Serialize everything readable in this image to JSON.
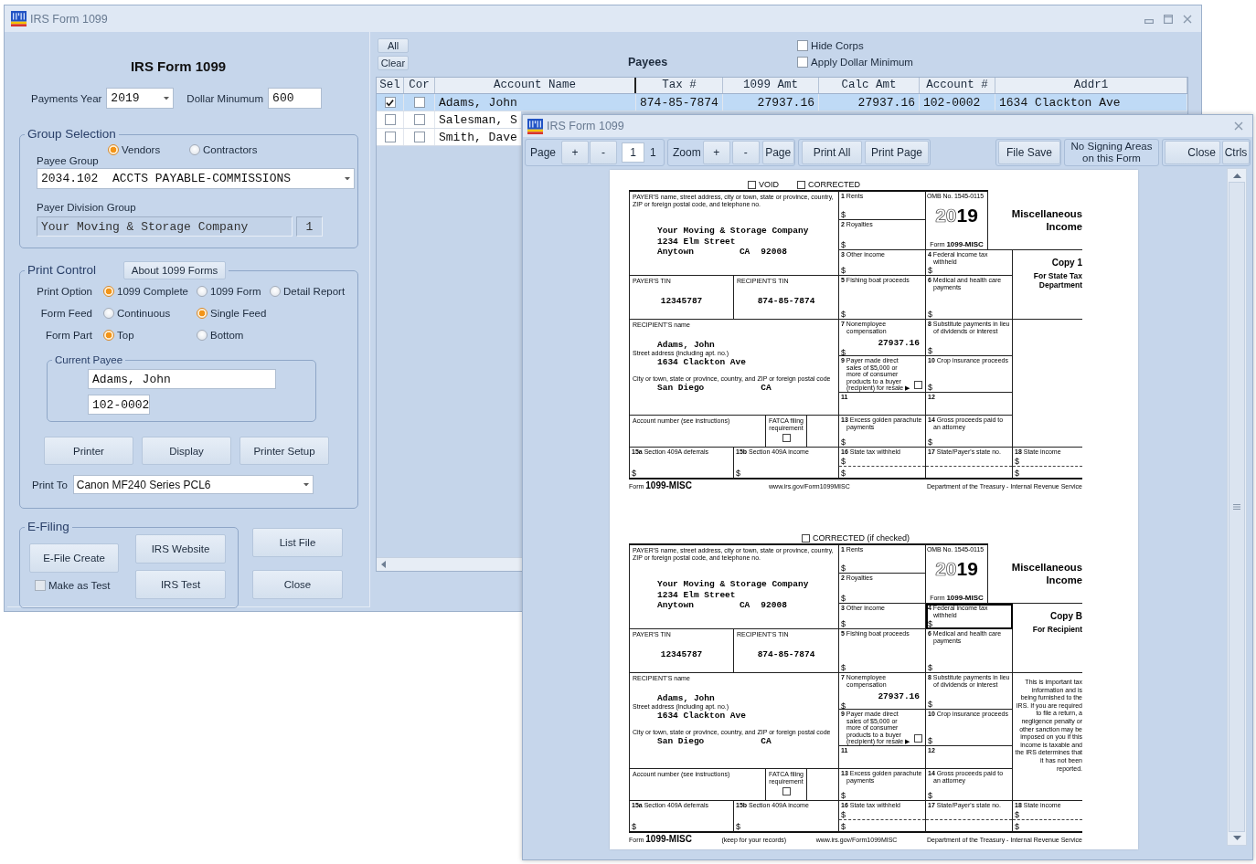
{
  "main_window": {
    "title": "IRS Form 1099",
    "left_panel": {
      "heading": "IRS Form 1099",
      "payments_year": {
        "label": "Payments Year",
        "value": "2019"
      },
      "dollar_minimum": {
        "label": "Dollar Minumum",
        "value": "600"
      },
      "group_selection": {
        "legend": "Group Selection",
        "payee_type": [
          {
            "label": "Vendors",
            "selected": true
          },
          {
            "label": "Contractors",
            "selected": false
          }
        ],
        "payee_group": {
          "label": "Payee Group",
          "value": "2034.102  ACCTS PAYABLE-COMMISSIONS"
        },
        "payer_division_group": {
          "label": "Payer Division Group",
          "value": "Your Moving & Storage Company",
          "number": "1"
        }
      },
      "print_control": {
        "legend": "Print Control",
        "about_button": "About 1099 Forms",
        "options": [
          {
            "label": "Print Option",
            "choices": [
              {
                "label": "1099 Complete",
                "selected": true
              },
              {
                "label": "1099 Form",
                "selected": false
              },
              {
                "label": "Detail Report",
                "selected": false
              }
            ]
          },
          {
            "label": "Form Feed",
            "choices": [
              {
                "label": "Continuous",
                "selected": false
              },
              {
                "label": "Single Feed",
                "selected": true
              }
            ]
          },
          {
            "label": "Form Part",
            "choices": [
              {
                "label": "Top",
                "selected": true
              },
              {
                "label": "Bottom",
                "selected": false
              }
            ]
          }
        ],
        "current_payee": {
          "legend": "Current Payee",
          "name": "Adams, John",
          "account": "102-0002"
        },
        "buttons": [
          "Printer",
          "Display",
          "Printer Setup"
        ],
        "print_to": {
          "label": "Print To",
          "value": "Canon MF240 Series PCL6"
        }
      },
      "e_filing": {
        "legend": "E-Filing",
        "create_button": "E-File Create",
        "make_as_test": {
          "label": "Make as Test",
          "checked": false
        },
        "website_button": "IRS Website",
        "test_button": "IRS Test"
      },
      "list_file_button": "List File",
      "close_button": "Close"
    },
    "payees": {
      "all_button": "All",
      "clear_button": "Clear",
      "title": "Payees",
      "filters": [
        {
          "label": "Hide Corps",
          "checked": false
        },
        {
          "label": "Apply Dollar Minimum",
          "checked": false
        }
      ],
      "table": {
        "check_columns": [
          "Sel",
          "Cor"
        ],
        "columns": [
          "Account Name",
          "Tax #",
          "1099 Amt",
          "Calc Amt",
          "Account #",
          "Addr1"
        ],
        "rows": [
          {
            "selected": true,
            "sel": true,
            "cor": false,
            "cells": [
              "Adams, John",
              "874-85-7874",
              "27937.16",
              "27937.16",
              "102-0002",
              "1634 Clackton Ave"
            ]
          },
          {
            "selected": false,
            "sel": false,
            "cor": false,
            "cells": [
              "Salesman, S"
            ]
          },
          {
            "selected": false,
            "sel": false,
            "cor": false,
            "cells": [
              "Smith, Dave"
            ]
          }
        ]
      }
    }
  },
  "preview_window": {
    "title": "IRS Form 1099",
    "toolbar": {
      "page": {
        "label": "Page",
        "buttons": [
          "+",
          "-"
        ],
        "current": "1",
        "total": "1"
      },
      "zoom": {
        "label": "Zoom",
        "buttons": [
          "+",
          "-",
          "Page"
        ]
      },
      "print_buttons": [
        "Print All",
        "Print Page"
      ],
      "file_save": "File Save",
      "signing_note": "No Signing Areas on this Form",
      "close": "Close",
      "ctrls": "Ctrls"
    },
    "page": {
      "copies": [
        {
          "top_checks": [
            {
              "label": "VOID",
              "checked": false
            },
            {
              "label": "CORRECTED",
              "checked": false
            }
          ],
          "payer": {
            "caption": "PAYER'S name, street address, city or town, state or province, country, ZIP or foreign postal code, and telephone no.",
            "name": "Your Moving & Storage Company",
            "street": "1234 Elm Street",
            "city": "Anytown",
            "state": "CA",
            "zip": "92008"
          },
          "omb": "OMB No. 1545-0115",
          "year_outlined": "20",
          "year_solid": "19",
          "form_name": "Form **1099-MISC**",
          "title": "Miscellaneous Income",
          "payer_tin": {
            "caption": "PAYER'S TIN",
            "value": "12345787"
          },
          "recipient_tin": {
            "caption": "RECIPIENT'S TIN",
            "value": "874-85-7874"
          },
          "recipient": {
            "name_caption": "RECIPIENT'S name",
            "name": "Adams, John",
            "street_caption": "Street address (including apt. no.)",
            "street": "1634 Clackton Ave",
            "city_caption": "City or town, state or province, country, and ZIP or foreign postal code",
            "city": "San Diego",
            "state": "CA"
          },
          "account": {
            "caption": "Account number (see instructions)"
          },
          "fatca": {
            "caption": "FATCA filing requirement",
            "checked": false
          },
          "boxes": [
            {
              "kind": "amount",
              "label": "**1** Rents",
              "amounts": [
                "$"
              ],
              "focused": false
            },
            {
              "kind": "amount",
              "label": "**2** Royalties",
              "amounts": [
                "$"
              ],
              "focused": false
            },
            {
              "kind": "amount",
              "label": "**3** Other income",
              "amounts": [
                "$"
              ],
              "focused": false
            },
            {
              "kind": "amount",
              "label": "**4** Federal income tax withheld",
              "amounts": [
                "$"
              ],
              "focused": false
            },
            {
              "kind": "amount",
              "label": "**5** Fishing boat proceeds",
              "amounts": [
                "$"
              ],
              "focused": false
            },
            {
              "kind": "amount",
              "label": "**6** Medical and health care payments",
              "amounts": [
                "$"
              ],
              "focused": false
            },
            {
              "kind": "amount",
              "label": "**7** Nonemployee compensation",
              "value": "27937.16",
              "amounts": [
                "$"
              ],
              "focused": false
            },
            {
              "kind": "amount",
              "label": "**8** Substitute payments in lieu of dividends or interest",
              "amounts": [
                "$"
              ],
              "focused": false
            },
            {
              "kind": "check",
              "label": "**9** Payer made direct sales of $5,000 or more of consumer products to a buyer (recipient) for resale ▶",
              "checked": false,
              "focused": false
            },
            {
              "kind": "amount",
              "label": "**10** Crop insurance proceeds",
              "amounts": [
                "$"
              ],
              "focused": false
            },
            {
              "kind": "plain",
              "label": "11",
              "focused": false
            },
            {
              "kind": "plain",
              "label": "12",
              "focused": false
            },
            {
              "kind": "amount",
              "label": "**13** Excess golden parachute payments",
              "amounts": [
                "$"
              ],
              "focused": false
            },
            {
              "kind": "amount",
              "label": "**14** Gross proceeds paid to an attorney",
              "amounts": [
                "$"
              ],
              "focused": false
            },
            {
              "kind": "amount",
              "label": "**15a** Section 409A deferrals",
              "amounts": [
                "$"
              ],
              "focused": false
            },
            {
              "kind": "amount",
              "label": "**15b** Section 409A income",
              "amounts": [
                "$"
              ],
              "focused": false
            },
            {
              "kind": "split",
              "label": "**16** State tax withheld",
              "amounts": [
                "$",
                "$"
              ],
              "focused": false
            },
            {
              "kind": "split",
              "label": "**17** State/Payer's state no.",
              "focused": false
            },
            {
              "kind": "split",
              "label": "**18** State income",
              "amounts": [
                "$",
                "$"
              ],
              "focused": false
            }
          ],
          "copy": {
            "title": "Copy 1",
            "subtitle": "For State Tax Department"
          },
          "footer": {
            "form_name": "Form **1099-MISC**",
            "url": "www.irs.gov/Form1099MISC",
            "agency": "Department of the Treasury - Internal Revenue Service"
          }
        },
        {
          "top_checks": [
            {
              "label": "CORRECTED (if checked)",
              "checked": false
            }
          ],
          "payer": {
            "caption": "PAYER'S name, street address, city or town, state or province, country, ZIP or foreign postal code, and telephone no.",
            "name": "Your Moving & Storage Company",
            "street": "1234 Elm Street",
            "city": "Anytown",
            "state": "CA",
            "zip": "92008"
          },
          "omb": "OMB No. 1545-0115",
          "year_outlined": "20",
          "year_solid": "19",
          "form_name": "Form **1099-MISC**",
          "title": "Miscellaneous Income",
          "payer_tin": {
            "caption": "PAYER'S TIN",
            "value": "12345787"
          },
          "recipient_tin": {
            "caption": "RECIPIENT'S TIN",
            "value": "874-85-7874"
          },
          "recipient": {
            "name_caption": "RECIPIENT'S name",
            "name": "Adams, John",
            "street_caption": "Street address (including apt. no.)",
            "street": "1634 Clackton Ave",
            "city_caption": "City or town, state or province, country, and ZIP or foreign postal code",
            "city": "San Diego",
            "state": "CA"
          },
          "account": {
            "caption": "Account number (see instructions)"
          },
          "fatca": {
            "caption": "FATCA filing requirement",
            "checked": false
          },
          "boxes": [
            {
              "kind": "amount",
              "label": "**1** Rents",
              "amounts": [
                "$"
              ],
              "focused": false
            },
            {
              "kind": "amount",
              "label": "**2** Royalties",
              "amounts": [
                "$"
              ],
              "focused": false
            },
            {
              "kind": "amount",
              "label": "**3** Other income",
              "amounts": [
                "$"
              ],
              "focused": false
            },
            {
              "kind": "amount",
              "label": "**4** Federal income tax withheld",
              "amounts": [
                "$"
              ],
              "focused": true
            },
            {
              "kind": "amount",
              "label": "**5** Fishing boat proceeds",
              "amounts": [
                "$"
              ],
              "focused": false
            },
            {
              "kind": "amount",
              "label": "**6** Medical and health care payments",
              "amounts": [
                "$"
              ],
              "focused": false
            },
            {
              "kind": "amount",
              "label": "**7** Nonemployee compensation",
              "value": "27937.16",
              "amounts": [
                "$"
              ],
              "focused": false
            },
            {
              "kind": "amount",
              "label": "**8** Substitute payments in lieu of dividends or interest",
              "amounts": [
                "$"
              ],
              "focused": false
            },
            {
              "kind": "check",
              "label": "**9** Payer made direct sales of $5,000 or more of consumer products to a buyer (recipient) for resale ▶",
              "checked": false,
              "focused": false
            },
            {
              "kind": "amount",
              "label": "**10** Crop insurance proceeds",
              "amounts": [
                "$"
              ],
              "focused": false
            },
            {
              "kind": "plain",
              "label": "11",
              "focused": false
            },
            {
              "kind": "plain",
              "label": "12",
              "focused": false
            },
            {
              "kind": "amount",
              "label": "**13** Excess golden parachute payments",
              "amounts": [
                "$"
              ],
              "focused": false
            },
            {
              "kind": "amount",
              "label": "**14** Gross proceeds paid to an attorney",
              "amounts": [
                "$"
              ],
              "focused": false
            },
            {
              "kind": "amount",
              "label": "**15a** Section 409A deferrals",
              "amounts": [
                "$"
              ],
              "focused": false
            },
            {
              "kind": "amount",
              "label": "**15b** Section 409A income",
              "amounts": [
                "$"
              ],
              "focused": false
            },
            {
              "kind": "split",
              "label": "**16** State tax withheld",
              "amounts": [
                "$",
                "$"
              ],
              "focused": false
            },
            {
              "kind": "split",
              "label": "**17** State/Payer's state no.",
              "focused": false
            },
            {
              "kind": "split",
              "label": "**18** State income",
              "amounts": [
                "$",
                "$"
              ],
              "focused": false
            }
          ],
          "copy": {
            "title": "Copy B",
            "subtitle": "For Recipient",
            "notice": "This is important tax information and is being furnished to the IRS. If you are required to file a return, a negligence penalty or other sanction may be imposed on you if this income is taxable and the IRS determines that it has not been reported."
          },
          "footer": {
            "form_name": "Form **1099-MISC**",
            "note": "(keep for your records)",
            "url": "www.irs.gov/Form1099MISC",
            "agency": "Department of the Treasury - Internal Revenue Service"
          }
        }
      ]
    }
  }
}
